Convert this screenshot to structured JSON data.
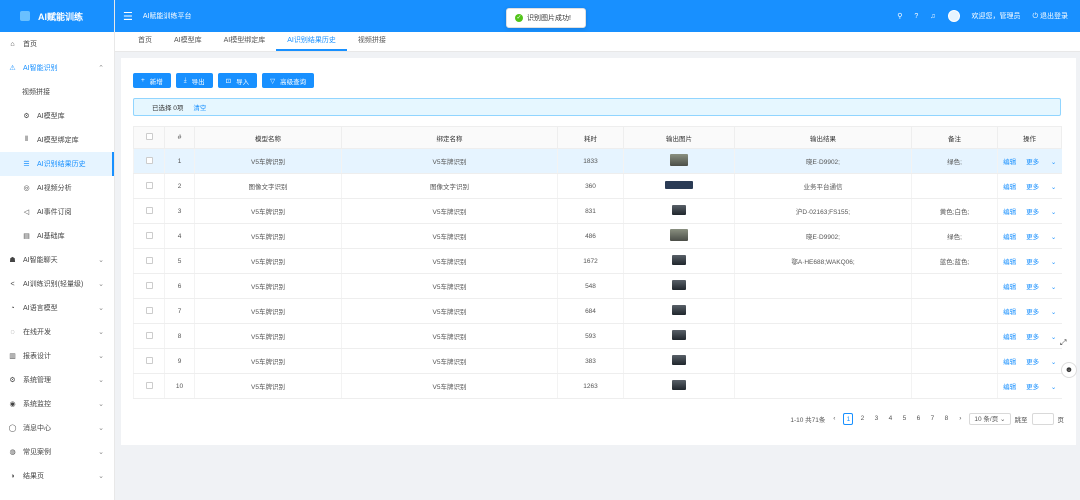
{
  "app": {
    "logo_text": "AI赋能训练",
    "brand_title": "AI赋能训练平台"
  },
  "header": {
    "welcome": "欢迎您，管理员",
    "logout": "退出登录"
  },
  "toast": {
    "message": "识别图片成功!"
  },
  "sidebar": {
    "items": [
      {
        "label": "首页",
        "icon": "home-icon"
      },
      {
        "label": "AI智能识别",
        "icon": "warning-icon"
      },
      {
        "label": "视频拼接",
        "icon": ""
      },
      {
        "label": "AI模型库",
        "icon": "gear-icon"
      },
      {
        "label": "AI模型绑定库",
        "icon": "barcode-icon"
      },
      {
        "label": "AI识别结果历史",
        "icon": "list-icon"
      },
      {
        "label": "AI视频分析",
        "icon": "video-icon"
      },
      {
        "label": "AI事件订阅",
        "icon": "bell-icon"
      },
      {
        "label": "AI基础库",
        "icon": "database-icon"
      },
      {
        "label": "AI智能聊天",
        "icon": "chat-icon"
      },
      {
        "label": "AI训练识别(轻量级)",
        "icon": "share-icon"
      },
      {
        "label": "AI语言模型",
        "icon": "model-icon"
      },
      {
        "label": "在线开发",
        "icon": "code-icon"
      },
      {
        "label": "报表设计",
        "icon": "chart-icon"
      },
      {
        "label": "系统管理",
        "icon": "settings-icon"
      },
      {
        "label": "系统监控",
        "icon": "monitor-icon"
      },
      {
        "label": "消息中心",
        "icon": "message-icon"
      },
      {
        "label": "常见案例",
        "icon": "case-icon"
      },
      {
        "label": "结果页",
        "icon": "result-icon"
      }
    ]
  },
  "tabs": [
    "首页",
    "AI模型库",
    "AI模型绑定库",
    "AI识别结果历史",
    "视频拼接"
  ],
  "toolbar": {
    "add": "新增",
    "export": "导出",
    "import": "导入",
    "advanced_query": "高级查询"
  },
  "alert": {
    "selected": "已选择 0项",
    "clear": "清空"
  },
  "table": {
    "columns": [
      "#",
      "模型名称",
      "绑定名称",
      "耗时",
      "输出图片",
      "输出结果",
      "备注",
      "操作"
    ],
    "rows": [
      {
        "n": "1",
        "model": "V5车牌识别",
        "bind": "V5车牌识别",
        "time": "1833",
        "result": "晓E·D9902;",
        "note": "绿色;"
      },
      {
        "n": "2",
        "model": "图像文字识别",
        "bind": "图像文字识别",
        "time": "360",
        "result": "业务平台通信",
        "note": ""
      },
      {
        "n": "3",
        "model": "V5车牌识别",
        "bind": "V5车牌识别",
        "time": "831",
        "result": "沪D·02163;FS155;",
        "note": "黄色;白色;"
      },
      {
        "n": "4",
        "model": "V5车牌识别",
        "bind": "V5车牌识别",
        "time": "486",
        "result": "晓E·D9902;",
        "note": "绿色;"
      },
      {
        "n": "5",
        "model": "V5车牌识别",
        "bind": "V5车牌识别",
        "time": "1672",
        "result": "鄂A·HE688;WAKQ06;",
        "note": "蓝色;蓝色;"
      },
      {
        "n": "6",
        "model": "V5车牌识别",
        "bind": "V5车牌识别",
        "time": "548",
        "result": "",
        "note": ""
      },
      {
        "n": "7",
        "model": "V5车牌识别",
        "bind": "V5车牌识别",
        "time": "684",
        "result": "",
        "note": ""
      },
      {
        "n": "8",
        "model": "V5车牌识别",
        "bind": "V5车牌识别",
        "time": "593",
        "result": "",
        "note": ""
      },
      {
        "n": "9",
        "model": "V5车牌识别",
        "bind": "V5车牌识别",
        "time": "383",
        "result": "",
        "note": ""
      },
      {
        "n": "10",
        "model": "V5车牌识别",
        "bind": "V5车牌识别",
        "time": "1263",
        "result": "",
        "note": ""
      }
    ],
    "ops": {
      "edit": "编辑",
      "more": "更多"
    }
  },
  "pagination": {
    "summary": "1-10 共71条",
    "pages": [
      "1",
      "2",
      "3",
      "4",
      "5",
      "6",
      "7",
      "8"
    ],
    "page_size": "10 条/页",
    "jump_label": "跳至",
    "page_unit": "页"
  },
  "colors": {
    "primary": "#1890ff",
    "success": "#52c41a",
    "highlight_row": "#e6f4ff"
  }
}
